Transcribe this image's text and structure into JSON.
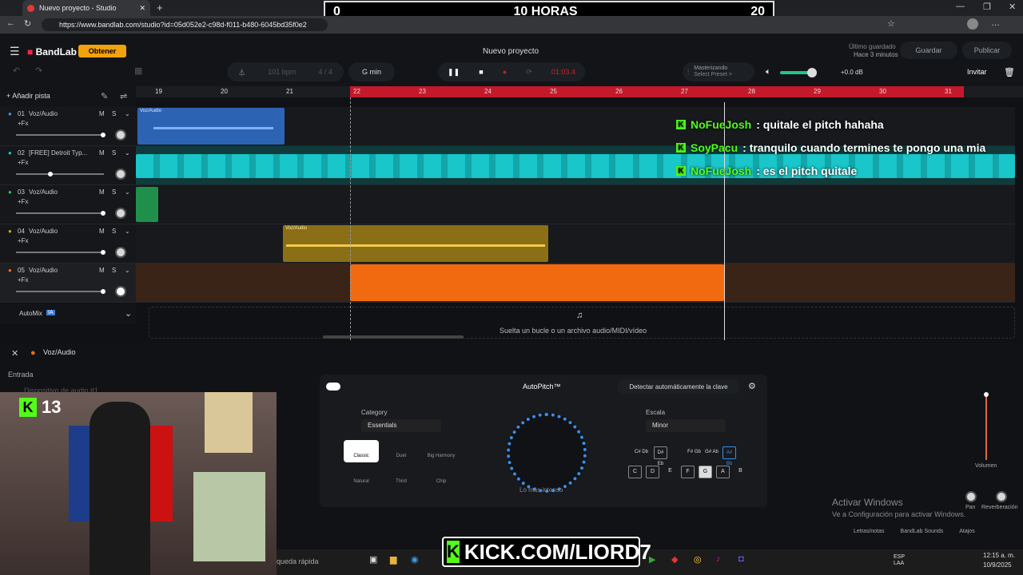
{
  "browser": {
    "tab_title": "Nuevo proyecto - Studio",
    "url": "https://www.bandlab.com/studio?id=05d052e2-c98d-f011-b480-6045bd35f0e2"
  },
  "overlay": {
    "timer_left": "0",
    "timer_title": "10 HORAS",
    "timer_right": "20"
  },
  "header": {
    "logo": "BandLab",
    "get_button": "Obtener",
    "project_title": "Nuevo proyecto",
    "saved_status": "Último guardado",
    "saved_time": "Hace 3 minutos",
    "save_button": "Guardar",
    "publish_button": "Publicar"
  },
  "transport": {
    "bpm": "101 bpm",
    "time_sig": "4 / 4",
    "key": "G min",
    "time": "01:03.4",
    "mastering_title": "Masterizando",
    "mastering_preset": "Select Preset >",
    "volume_db": "+0.0 dB",
    "invite": "Invitar"
  },
  "ruler": {
    "bars": [
      "19",
      "20",
      "21",
      "22",
      "23",
      "24",
      "25",
      "26",
      "27",
      "28",
      "29",
      "30",
      "31"
    ]
  },
  "tracks": [
    {
      "num": "01",
      "name": "Voz/Audio",
      "fx": "+Fx",
      "clip": "Voz/Audio"
    },
    {
      "num": "02",
      "name": "[FREE] Detroit Typ...",
      "fx": "+Fx",
      "clip": ""
    },
    {
      "num": "03",
      "name": "Voz/Audio",
      "fx": "+Fx",
      "clip": ""
    },
    {
      "num": "04",
      "name": "Voz/Audio",
      "fx": "+Fx",
      "clip": "Voz/Audio"
    },
    {
      "num": "05",
      "name": "Voz/Audio",
      "fx": "+Fx",
      "clip": ""
    }
  ],
  "track_buttons": {
    "mute": "M",
    "solo": "S"
  },
  "add_track": "Añadir pista",
  "automix": {
    "label": "AutoMix",
    "badge": "IA"
  },
  "drop_zone": "Suelta un bucle o un archivo audio/MIDI/vídeo",
  "chat": [
    {
      "user": "NoFueJosh",
      "msg": ": quitale el pitch hahaha"
    },
    {
      "user": "SoyPacu",
      "msg": ": tranquilo cuando termines te pongo una mia"
    },
    {
      "user": "NoFueJosh",
      "msg": ": es el pitch quitale"
    }
  ],
  "bottom": {
    "track_name": "Voz/Audio",
    "input_label": "Entrada",
    "input_placeholder": "Dispositivo de audio #1",
    "autopitch_title": "AutoPitch™",
    "detect_key": "Detectar automáticamente la clave",
    "category_label": "Category",
    "category_value": "Essentials",
    "presets": [
      "Classic",
      "Duet",
      "Big Harmony",
      "Natural",
      "Third",
      "Chip"
    ],
    "knob_label": "Lo más intenso",
    "scale_label": "Escala",
    "scale_value": "Minor",
    "sharp_keys": [
      "C#\nDb",
      "D#\nEb",
      "F#\nGb",
      "G#\nAb",
      "A#\nBb"
    ],
    "natural_keys": [
      "C",
      "D",
      "E",
      "F",
      "G",
      "A",
      "B"
    ],
    "volume_label": "Volumen",
    "pan_label": "Pan",
    "reverb_label": "Reverberación",
    "lyrics": "Letras/notas",
    "sounds": "BandLab Sounds",
    "shortcuts": "Atajos"
  },
  "windows": {
    "activate": "Activar Windows",
    "activate_sub": "Ve a Configuración para activar Windows.",
    "search": "queda rápida",
    "lang": "ESP\nLAA",
    "time": "12:15 a. m.",
    "date": "10/9/2025"
  },
  "stream": {
    "subs": "13",
    "banner": "KICK.COM/LIORD7"
  },
  "colors": {
    "accent_orange": "#f26a10",
    "teal": "#19c6c9",
    "blue_clip": "#2d63b3",
    "yellow_clip": "#c9a42a",
    "kick_green": "#53fc18",
    "ruler_red": "#c4192b"
  }
}
